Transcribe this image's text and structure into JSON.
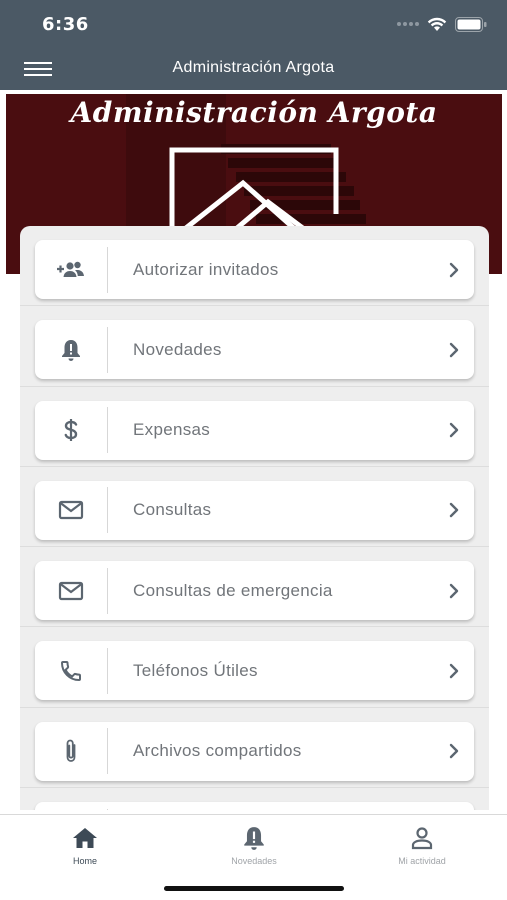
{
  "status_bar": {
    "time": "6:36",
    "icons": [
      "signal-icon",
      "wifi-icon",
      "battery-icon"
    ]
  },
  "nav": {
    "title": "Administración Argota",
    "menu_icon": "hamburger-icon"
  },
  "banner": {
    "title": "Administración Argota",
    "background": "#4a0d10"
  },
  "menu": {
    "items": [
      {
        "label": "Autorizar invitados",
        "icon": "add-group-icon"
      },
      {
        "label": "Novedades",
        "icon": "bell-alert-icon"
      },
      {
        "label": "Expensas",
        "icon": "dollar-icon"
      },
      {
        "label": "Consultas",
        "icon": "mail-icon"
      },
      {
        "label": "Consultas de emergencia",
        "icon": "mail-icon"
      },
      {
        "label": "Teléfonos Útiles",
        "icon": "phone-icon"
      },
      {
        "label": "Archivos compartidos",
        "icon": "paperclip-icon"
      }
    ]
  },
  "tabs": [
    {
      "label": "Home",
      "icon": "home-icon",
      "active": true
    },
    {
      "label": "Novedades",
      "icon": "bell-alert-icon",
      "active": false
    },
    {
      "label": "Mi actividad",
      "icon": "user-icon",
      "active": false
    }
  ],
  "colors": {
    "header": "#4b5965",
    "accent": "#3d4a56",
    "text": "#71757a",
    "panel": "#eeeeee"
  }
}
